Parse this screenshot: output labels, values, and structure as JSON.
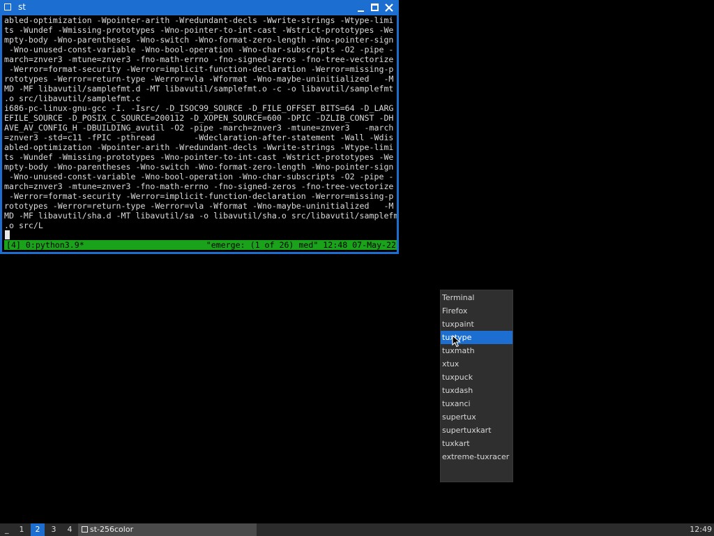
{
  "window": {
    "title": "st",
    "terminal_lines": [
      "abled-optimization -Wpointer-arith -Wredundant-decls -Wwrite-strings -Wtype-limi",
      "ts -Wundef -Wmissing-prototypes -Wno-pointer-to-int-cast -Wstrict-prototypes -We",
      "mpty-body -Wno-parentheses -Wno-switch -Wno-format-zero-length -Wno-pointer-sign",
      " -Wno-unused-const-variable -Wno-bool-operation -Wno-char-subscripts -O2 -pipe -",
      "march=znver3 -mtune=znver3 -fno-math-errno -fno-signed-zeros -fno-tree-vectorize",
      " -Werror=format-security -Werror=implicit-function-declaration -Werror=missing-p",
      "rototypes -Werror=return-type -Werror=vla -Wformat -Wno-maybe-uninitialized   -M",
      "MD -MF libavutil/samplefmt.d -MT libavutil/samplefmt.o -c -o libavutil/samplefmt",
      ".o src/libavutil/samplefmt.c",
      "i686-pc-linux-gnu-gcc -I. -Isrc/ -D_ISOC99_SOURCE -D_FILE_OFFSET_BITS=64 -D_LARG",
      "EFILE_SOURCE -D_POSIX_C_SOURCE=200112 -D_XOPEN_SOURCE=600 -DPIC -DZLIB_CONST -DH",
      "AVE_AV_CONFIG_H -DBUILDING_avutil -O2 -pipe -march=znver3 -mtune=znver3   -march",
      "=znver3 -std=c11 -fPIC -pthread        -Wdeclaration-after-statement -Wall -Wdis",
      "abled-optimization -Wpointer-arith -Wredundant-decls -Wwrite-strings -Wtype-limi",
      "ts -Wundef -Wmissing-prototypes -Wno-pointer-to-int-cast -Wstrict-prototypes -We",
      "mpty-body -Wno-parentheses -Wno-switch -Wno-format-zero-length -Wno-pointer-sign",
      " -Wno-unused-const-variable -Wno-bool-operation -Wno-char-subscripts -O2 -pipe -",
      "march=znver3 -mtune=znver3 -fno-math-errno -fno-signed-zeros -fno-tree-vectorize",
      " -Werror=format-security -Werror=implicit-function-declaration -Werror=missing-p",
      "rototypes -Werror=return-type -Werror=vla -Wformat -Wno-maybe-uninitialized   -M",
      "MD -MF libavutil/sha.d -MT libavutil/sa -o libavutil/sha.o src/libavutil/samplefmt",
      ".o src/L"
    ],
    "status_left": "[4] 0:python3.9*",
    "status_right": "\"emerge: (1 of 26) med\" 12:48 07-May-22"
  },
  "menu": {
    "items": [
      "Terminal",
      "Firefox",
      "tuxpaint",
      "tuxtype",
      "tuxmath",
      "xtux",
      "tuxpuck",
      "tuxdash",
      "tuxanci",
      "supertux",
      "supertuxkart",
      "tuxkart",
      "extreme-tuxracer"
    ],
    "selected": "tuxtype"
  },
  "taskbar": {
    "first": "_",
    "desktops": [
      "1",
      "2",
      "3",
      "4"
    ],
    "active_desktop": "2",
    "task_label": "st-256color",
    "clock": "12:49"
  },
  "colors": {
    "accent": "#1c6fd1",
    "status_green": "#1aa31a",
    "menu_bg": "#2f2f2f",
    "taskbar_bg": "#2b2b2b"
  }
}
